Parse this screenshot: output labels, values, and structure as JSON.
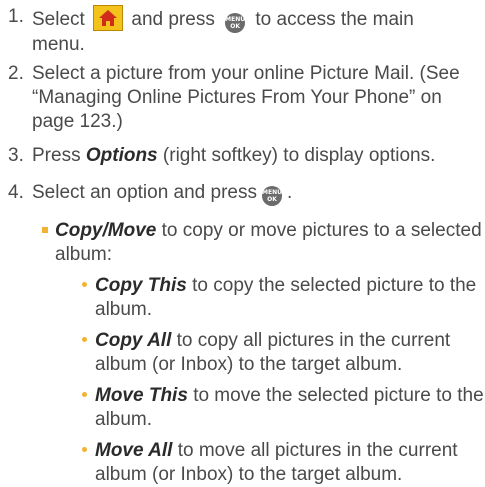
{
  "steps": [
    {
      "num": "1.",
      "pre": "Select",
      "mid": "and press",
      "post": "to access the main",
      "line2": "menu."
    },
    {
      "num": "2.",
      "line1": "Select a picture from your online Picture Mail. (See",
      "line2": "“Managing Online Pictures From Your Phone” on",
      "line3": "page 123.)"
    },
    {
      "num": "3.",
      "pre": "Press",
      "em": "Options",
      "post": "(right softkey) to display options."
    },
    {
      "num": "4.",
      "pre": "Select an option and press",
      "post": "."
    }
  ],
  "copy_move": {
    "em": "Copy/Move",
    "line1": "to copy or move pictures to a selected",
    "line2": "album:"
  },
  "sub_options": [
    {
      "em": "Copy This",
      "line1": "to copy the selected picture to the",
      "line2": "album."
    },
    {
      "em": "Copy All",
      "line1": "to copy all pictures in the current",
      "line2": "album (or Inbox) to the target album."
    },
    {
      "em": "Move This",
      "line1": "to move the selected picture to the",
      "line2": "album."
    },
    {
      "em": "Move All",
      "line1": "to move all pictures in the current",
      "line2": "album (or Inbox) to the target album."
    }
  ],
  "icons": {
    "home": "home-icon",
    "menu_ok": "menu-ok-key-icon",
    "menu_key_text_1": "MENU",
    "menu_key_text_2": "OK"
  },
  "colors": {
    "bullet": "#f2b232",
    "home_icon_bg": "#f3c21b",
    "home_icon_glyph": "#d12b1c",
    "text": "#4a4a4a"
  }
}
